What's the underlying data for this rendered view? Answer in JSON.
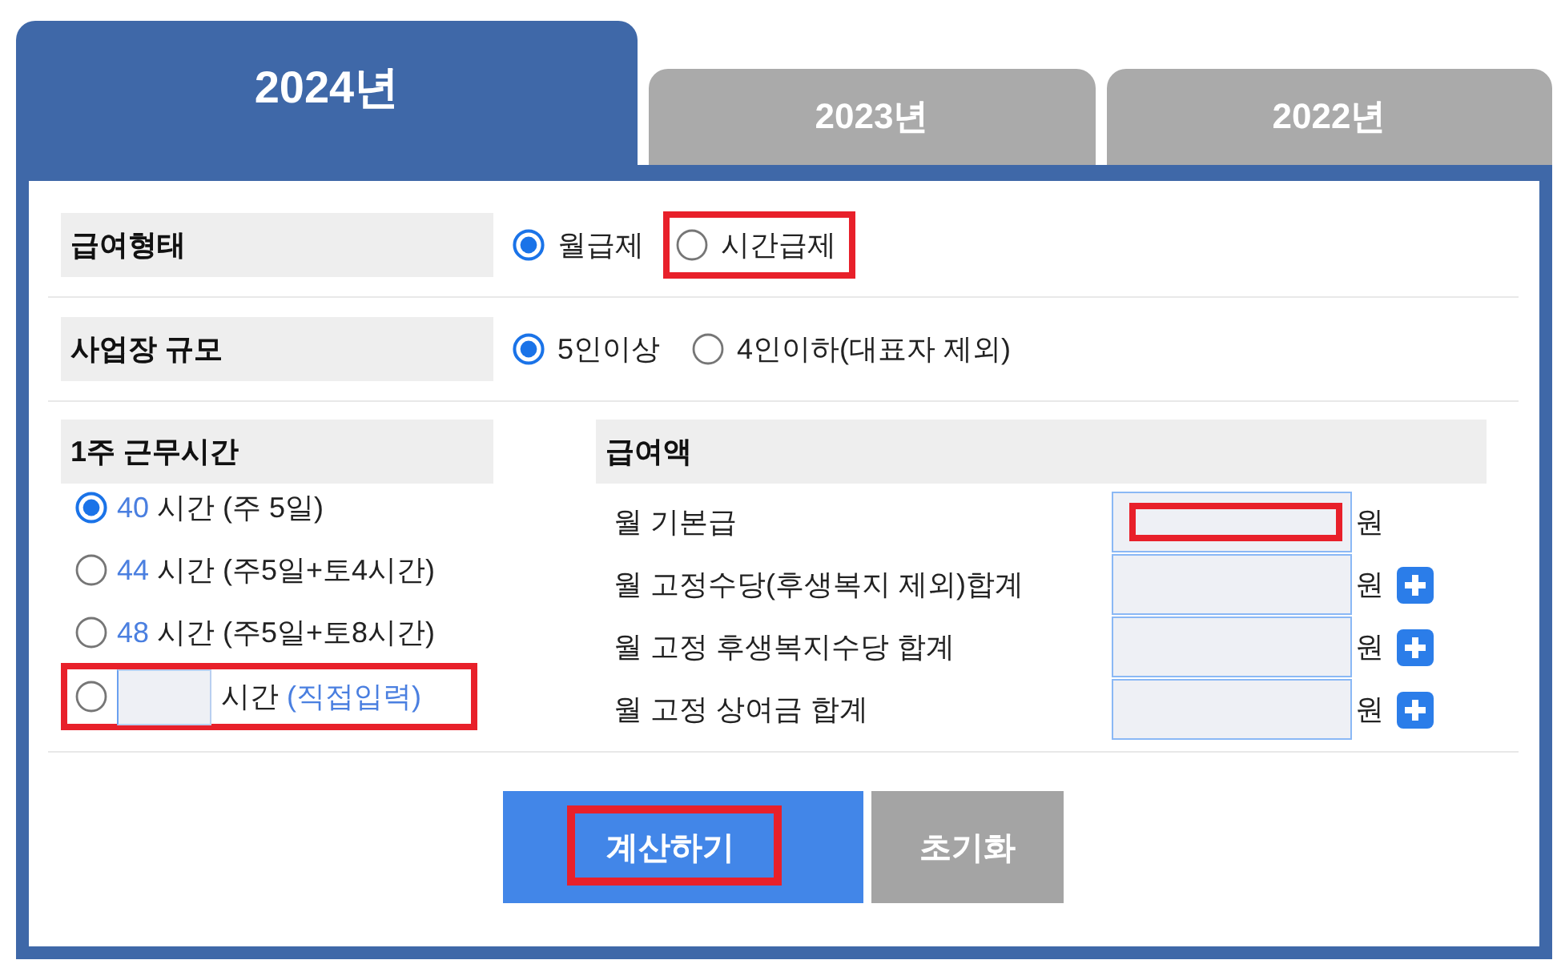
{
  "tabs": [
    {
      "label": "2024년",
      "selected": true
    },
    {
      "label": "2023년",
      "selected": false
    },
    {
      "label": "2022년",
      "selected": false
    }
  ],
  "pay_type": {
    "label": "급여형태",
    "options": [
      {
        "label": "월급제",
        "selected": true,
        "highlighted": false
      },
      {
        "label": "시간급제",
        "selected": false,
        "highlighted": true
      }
    ]
  },
  "workplace_size": {
    "label": "사업장 규모",
    "options": [
      {
        "label": "5인이상",
        "selected": true
      },
      {
        "label": "4인이하(대표자 제외)",
        "selected": false
      }
    ]
  },
  "weekly_hours": {
    "label": "1주 근무시간",
    "options": [
      {
        "kind": "preset",
        "hours": "40",
        "text": "시간 (주 5일)",
        "selected": true,
        "highlighted": false
      },
      {
        "kind": "preset",
        "hours": "44",
        "text": "시간 (주5일+토4시간)",
        "selected": false,
        "highlighted": false
      },
      {
        "kind": "preset",
        "hours": "48",
        "text": "시간 (주5일+토8시간)",
        "selected": false,
        "highlighted": false
      },
      {
        "kind": "custom",
        "text": "시간",
        "note": "(직접입력)",
        "selected": false,
        "highlighted": true
      }
    ]
  },
  "pay_amount": {
    "label": "급여액",
    "fields": [
      {
        "label": "월 기본급",
        "unit": "원",
        "add_button": false,
        "highlighted": true
      },
      {
        "label": "월 고정수당(후생복지 제외)합계",
        "unit": "원",
        "add_button": true,
        "highlighted": false
      },
      {
        "label": "월 고정 후생복지수당 합계",
        "unit": "원",
        "add_button": true,
        "highlighted": false
      },
      {
        "label": "월 고정 상여금 합계",
        "unit": "원",
        "add_button": true,
        "highlighted": false
      }
    ]
  },
  "buttons": [
    {
      "label": "계산하기",
      "kind": "primary",
      "highlighted": true
    },
    {
      "label": "초기화",
      "kind": "secondary",
      "highlighted": false
    }
  ]
}
